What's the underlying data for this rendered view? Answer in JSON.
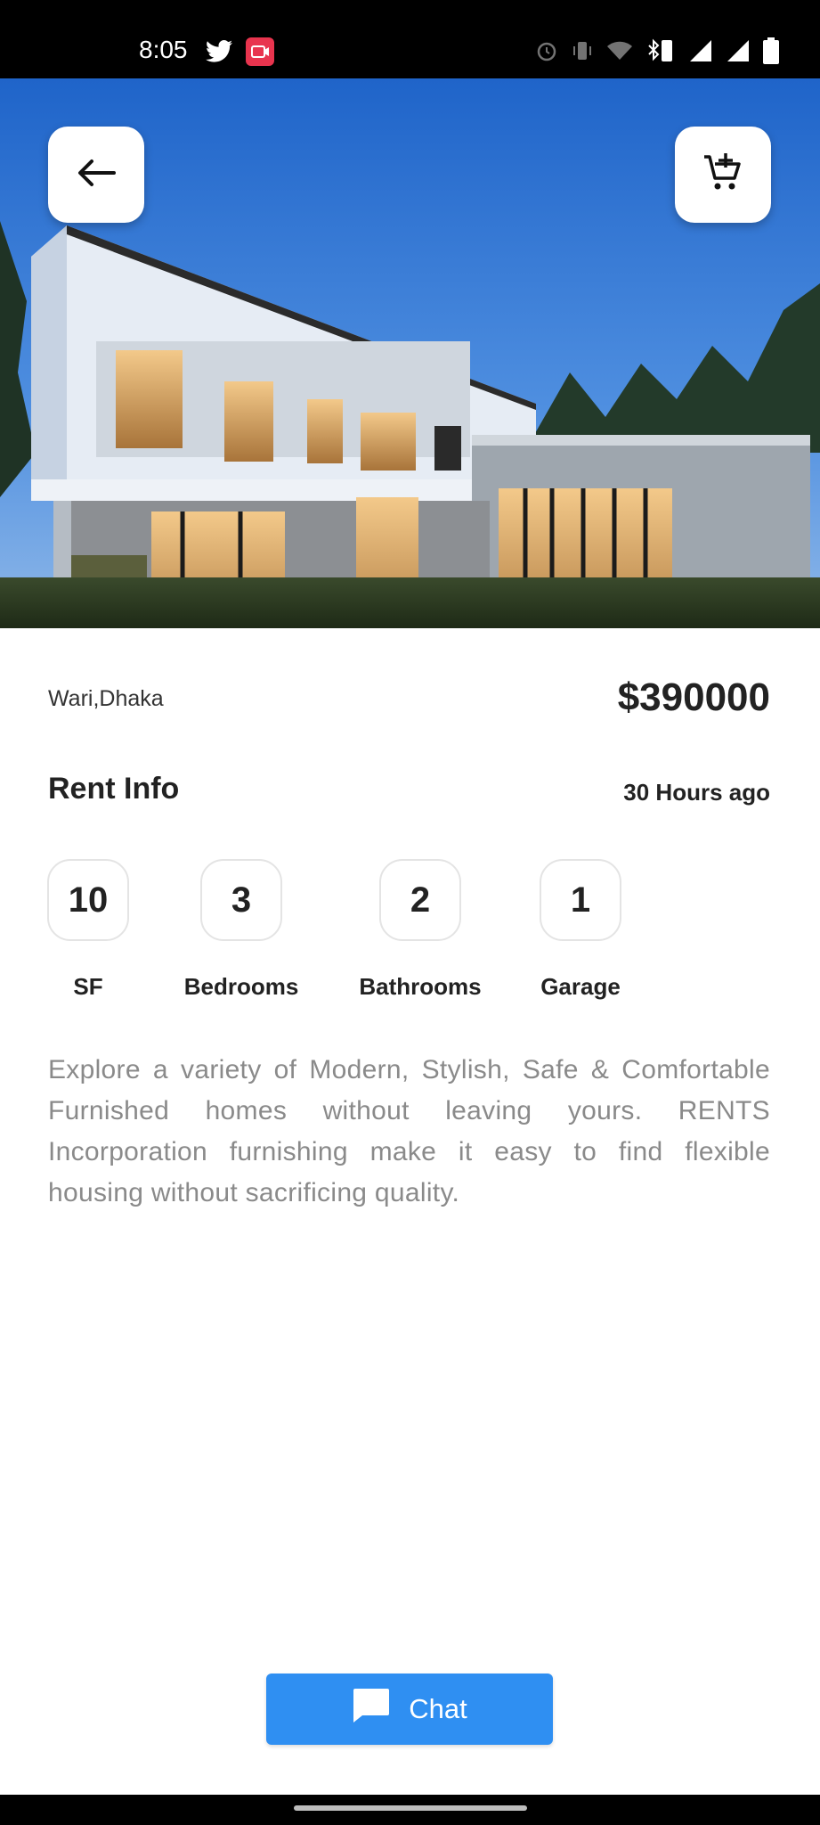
{
  "status_bar": {
    "time": "8:05",
    "left_icons": [
      "twitter-icon",
      "screen-record-icon"
    ],
    "right_icons": [
      "alarm-icon",
      "vibrate-icon",
      "wifi-icon",
      "bluetooth-icon",
      "signal-icon",
      "signal-icon",
      "battery-icon"
    ]
  },
  "header": {
    "back_icon": "arrow-left-icon",
    "cart_icon": "add-to-cart-icon"
  },
  "property": {
    "location": "Wari,Dhaka",
    "price": "$390000"
  },
  "rent_info": {
    "title": "Rent Info",
    "posted": "30 Hours ago",
    "features": [
      {
        "value": "10",
        "label": "SF"
      },
      {
        "value": "3",
        "label": "Bedrooms"
      },
      {
        "value": "2",
        "label": "Bathrooms"
      },
      {
        "value": "1",
        "label": "Garage"
      }
    ]
  },
  "description": "Explore a variety of Modern, Stylish, Safe & Comfortable Furnished homes without leaving yours. RENTS Incorporation furnishing make it easy to find flexible housing without sacrificing quality.",
  "chat_button": {
    "label": "Chat",
    "icon": "chat-bubble-icon"
  },
  "colors": {
    "accent": "#2f8ff2",
    "text_dark": "#222222",
    "text_muted": "#8a8a8a"
  }
}
